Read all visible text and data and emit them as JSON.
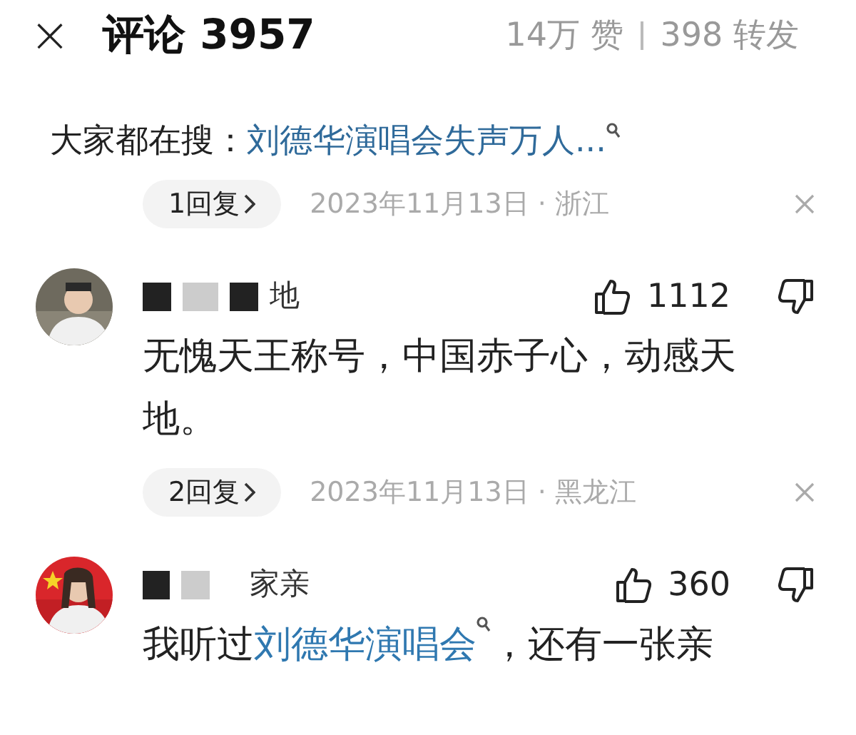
{
  "header": {
    "close": "×",
    "title": "评论 3957",
    "likes": "14万 赞",
    "shares": "398 转发"
  },
  "hot_search": {
    "label": "大家都在搜：",
    "query": "刘德华演唱会失声万人..."
  },
  "top_meta": {
    "replies": "1回复",
    "date": "2023年11月13日 · 浙江"
  },
  "comments": [
    {
      "username": "地",
      "likes": "1112",
      "body": [
        {
          "kind": "text",
          "text": "无愧天王称号，中国赤子心，动感天地。"
        }
      ],
      "replies": "2回复",
      "date": "2023年11月13日 · 黑龙江",
      "avatar": {
        "kind": "picture"
      }
    },
    {
      "username": "家亲",
      "likes": "360",
      "body": [
        {
          "kind": "text",
          "text": "我听过"
        },
        {
          "kind": "link",
          "text": "刘德华演唱会"
        },
        {
          "kind": "text",
          "text": "，还有一张亲"
        }
      ],
      "avatar": {
        "kind": "picture"
      }
    }
  ]
}
